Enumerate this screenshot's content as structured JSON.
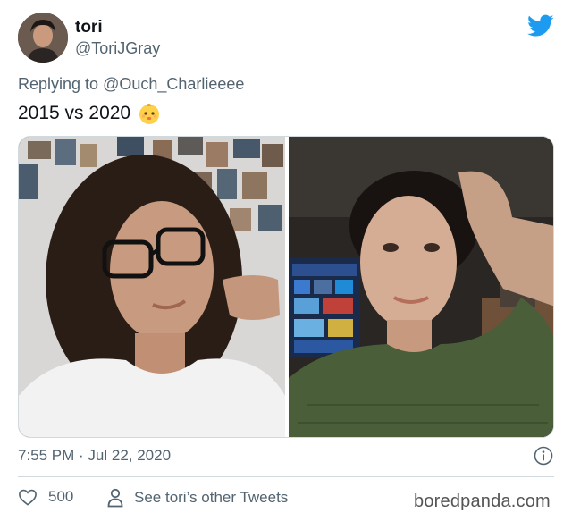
{
  "tweet": {
    "display_name": "tori",
    "handle": "@ToriJGray",
    "reply_prefix": "Replying to",
    "reply_mention": "@Ouch_Charlieeee",
    "text": "2015 vs 2020",
    "emoji": "baby-face-emoji",
    "timestamp": "7:55 PM · Jul 22, 2020",
    "likes": "500",
    "see_other": "See tori’s other Tweets"
  },
  "media": {
    "photos": [
      "photo-2015",
      "photo-2020"
    ]
  },
  "watermark": "boredpanda.com",
  "colors": {
    "twitter_blue": "#1d9bf0",
    "secondary_text": "#536471",
    "primary_text": "#0f1419",
    "border": "#cfd9de"
  },
  "icons": {
    "brand": "twitter-bird-icon",
    "info": "info-icon",
    "like": "heart-icon",
    "profile": "person-icon"
  }
}
